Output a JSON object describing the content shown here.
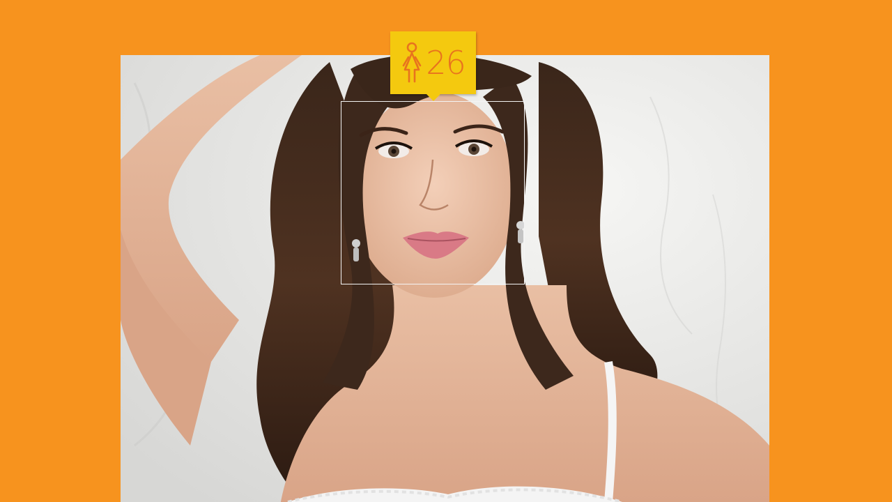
{
  "age_badge": {
    "age": "26",
    "gender_icon": "female-person-icon",
    "background_color": "#F4C90F",
    "text_color": "#E8731E"
  },
  "colors": {
    "page_background": "#F7931E",
    "face_box_border": "#f4f4f4"
  }
}
